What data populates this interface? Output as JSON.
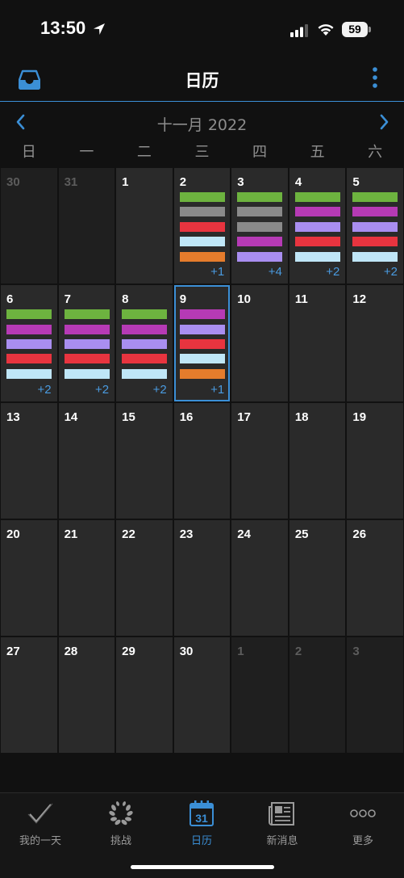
{
  "status_bar": {
    "time": "13:50",
    "battery": "59"
  },
  "nav": {
    "title": "日历"
  },
  "month": {
    "label": "十一月 2022"
  },
  "weekdays": [
    "日",
    "一",
    "二",
    "三",
    "四",
    "五",
    "六"
  ],
  "colors": {
    "green": "#6db33f",
    "gray": "#8a8a8a",
    "red": "#e8343f",
    "lightblue": "#bfe6f7",
    "orange": "#e57c2c",
    "magenta": "#b63ab5",
    "lavender": "#a98ef0",
    "accent": "#3b8fd6"
  },
  "days": [
    {
      "n": "30",
      "other": true
    },
    {
      "n": "31",
      "other": true
    },
    {
      "n": "1"
    },
    {
      "n": "2",
      "bars": [
        "green",
        "gray",
        "red",
        "lightblue",
        "orange"
      ],
      "more": "+1"
    },
    {
      "n": "3",
      "bars": [
        "green",
        "gray",
        "gray",
        "magenta",
        "lavender"
      ],
      "more": "+4"
    },
    {
      "n": "4",
      "bars": [
        "green",
        "magenta",
        "lavender",
        "red",
        "lightblue"
      ],
      "more": "+2"
    },
    {
      "n": "5",
      "bars": [
        "green",
        "magenta",
        "lavender",
        "red",
        "lightblue"
      ],
      "more": "+2"
    },
    {
      "n": "6",
      "bars": [
        "green",
        "magenta",
        "lavender",
        "red",
        "lightblue"
      ],
      "more": "+2"
    },
    {
      "n": "7",
      "bars": [
        "green",
        "magenta",
        "lavender",
        "red",
        "lightblue"
      ],
      "more": "+2"
    },
    {
      "n": "8",
      "bars": [
        "green",
        "magenta",
        "lavender",
        "red",
        "lightblue"
      ],
      "more": "+2"
    },
    {
      "n": "9",
      "bars": [
        "magenta",
        "lavender",
        "red",
        "lightblue",
        "orange"
      ],
      "more": "+1",
      "selected": true
    },
    {
      "n": "10"
    },
    {
      "n": "11"
    },
    {
      "n": "12"
    },
    {
      "n": "13"
    },
    {
      "n": "14"
    },
    {
      "n": "15"
    },
    {
      "n": "16"
    },
    {
      "n": "17"
    },
    {
      "n": "18"
    },
    {
      "n": "19"
    },
    {
      "n": "20"
    },
    {
      "n": "21"
    },
    {
      "n": "22"
    },
    {
      "n": "23"
    },
    {
      "n": "24"
    },
    {
      "n": "25"
    },
    {
      "n": "26"
    },
    {
      "n": "27"
    },
    {
      "n": "28"
    },
    {
      "n": "29"
    },
    {
      "n": "30"
    },
    {
      "n": "1",
      "other": true
    },
    {
      "n": "2",
      "other": true
    },
    {
      "n": "3",
      "other": true
    }
  ],
  "tabs": [
    {
      "label": "我的一天",
      "icon": "checkmark-icon"
    },
    {
      "label": "挑战",
      "icon": "laurel-icon"
    },
    {
      "label": "日历",
      "icon": "calendar-icon",
      "active": true,
      "icon_text": "31"
    },
    {
      "label": "新消息",
      "icon": "newspaper-icon"
    },
    {
      "label": "更多",
      "icon": "more-dots-icon"
    }
  ]
}
